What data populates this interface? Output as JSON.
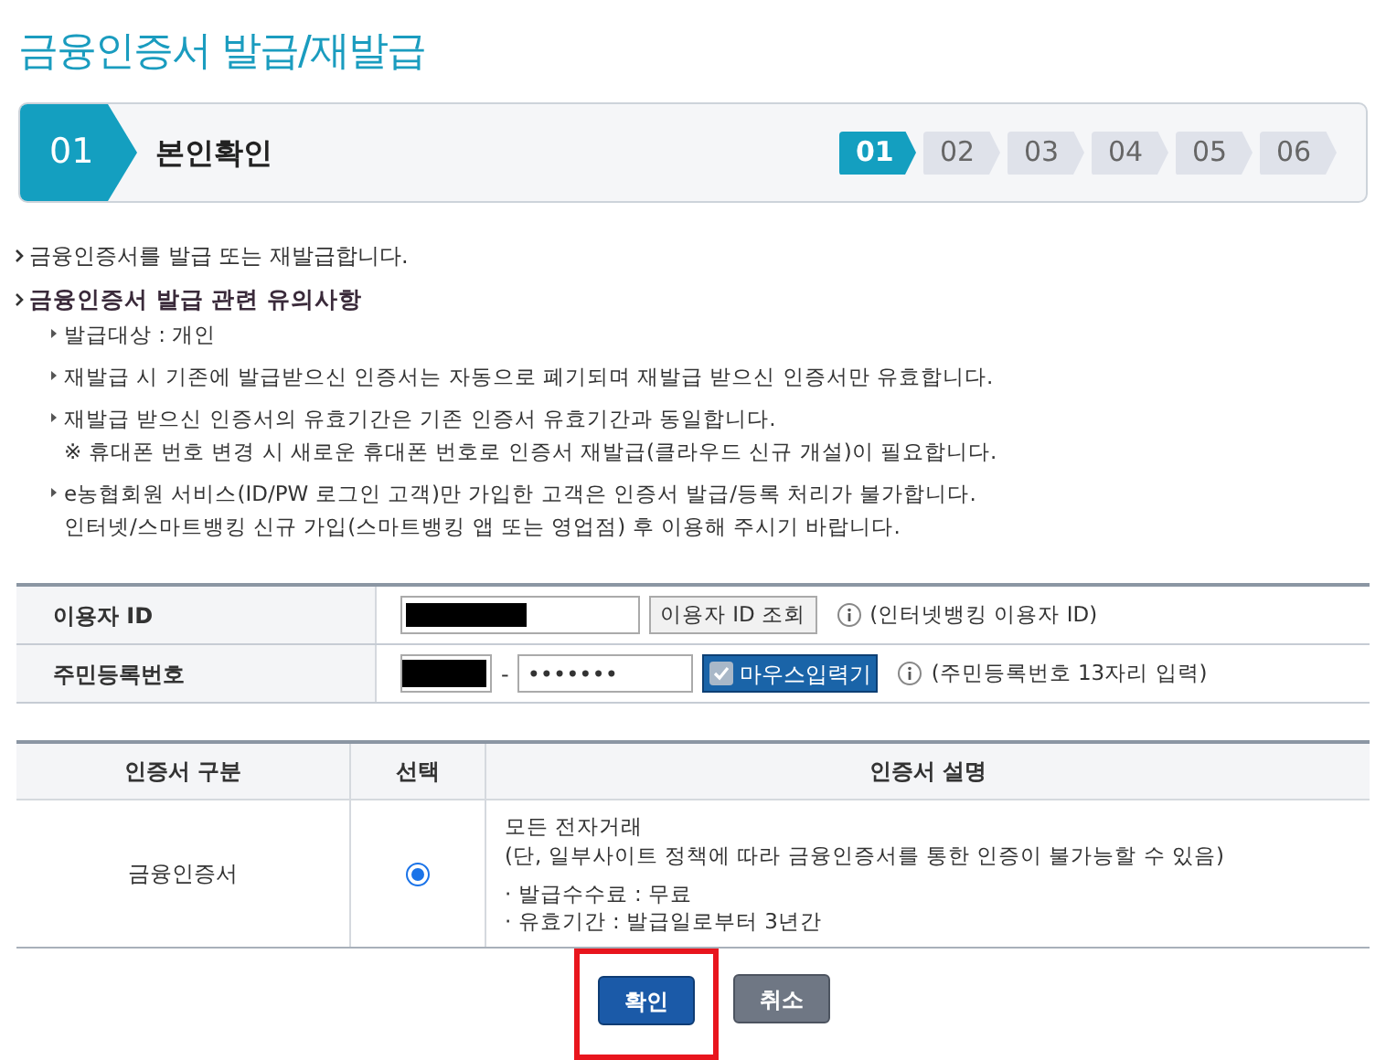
{
  "title": "금융인증서 발급/재발급",
  "current_step": {
    "number": "01",
    "label": "본인확인"
  },
  "steps": [
    {
      "label": "01",
      "selected": true
    },
    {
      "label": "02",
      "selected": false
    },
    {
      "label": "03",
      "selected": false
    },
    {
      "label": "04",
      "selected": false
    },
    {
      "label": "05",
      "selected": false
    },
    {
      "label": "06",
      "selected": false
    }
  ],
  "intro": "금융인증서를 발급 또는 재발급합니다.",
  "notice_heading": "금융인증서 발급 관련 유의사항",
  "notices": [
    {
      "lines": [
        "발급대상 : 개인"
      ]
    },
    {
      "lines": [
        "재발급 시 기존에 발급받으신 인증서는 자동으로 폐기되며 재발급 받으신 인증서만 유효합니다."
      ]
    },
    {
      "lines": [
        "재발급 받으신 인증서의 유효기간은 기존 인증서 유효기간과 동일합니다.",
        "※ 휴대폰 번호 변경 시 새로운 휴대폰 번호로 인증서 재발급(클라우드 신규 개설)이 필요합니다."
      ]
    },
    {
      "lines": [
        "e농협회원 서비스(ID/PW 로그인 고객)만 가입한 고객은 인증서 발급/등록 처리가 불가합니다.",
        "인터넷/스마트뱅킹 신규 가입(스마트뱅킹 앱 또는 영업점) 후 이용해 주시기 바랍니다."
      ]
    }
  ],
  "form": {
    "user_id": {
      "label": "이용자 ID",
      "button": "이용자 ID 조회",
      "note": "(인터넷뱅킹 이용자 ID)"
    },
    "resident_number": {
      "label": "주민등록번호",
      "separator": "-",
      "second_part": "•••••••",
      "mouse_input": {
        "label": "마우스입력기",
        "checked": true
      },
      "note": "(주민등록번호 13자리 입력)"
    }
  },
  "cert_table": {
    "columns": [
      "인증서 구분",
      "선택",
      "인증서 설명"
    ],
    "rows": [
      {
        "type": "금융인증서",
        "selected": true,
        "description": [
          "모든 전자거래",
          "(단, 일부사이트 정책에 따라 금융인증서를 통한 인증이 불가능할 수 있음)"
        ],
        "details": [
          "· 발급수수료 : 무료",
          "· 유효기간 : 발급일로부터 3년간"
        ]
      }
    ]
  },
  "buttons": {
    "confirm": "확인",
    "cancel": "취소"
  }
}
